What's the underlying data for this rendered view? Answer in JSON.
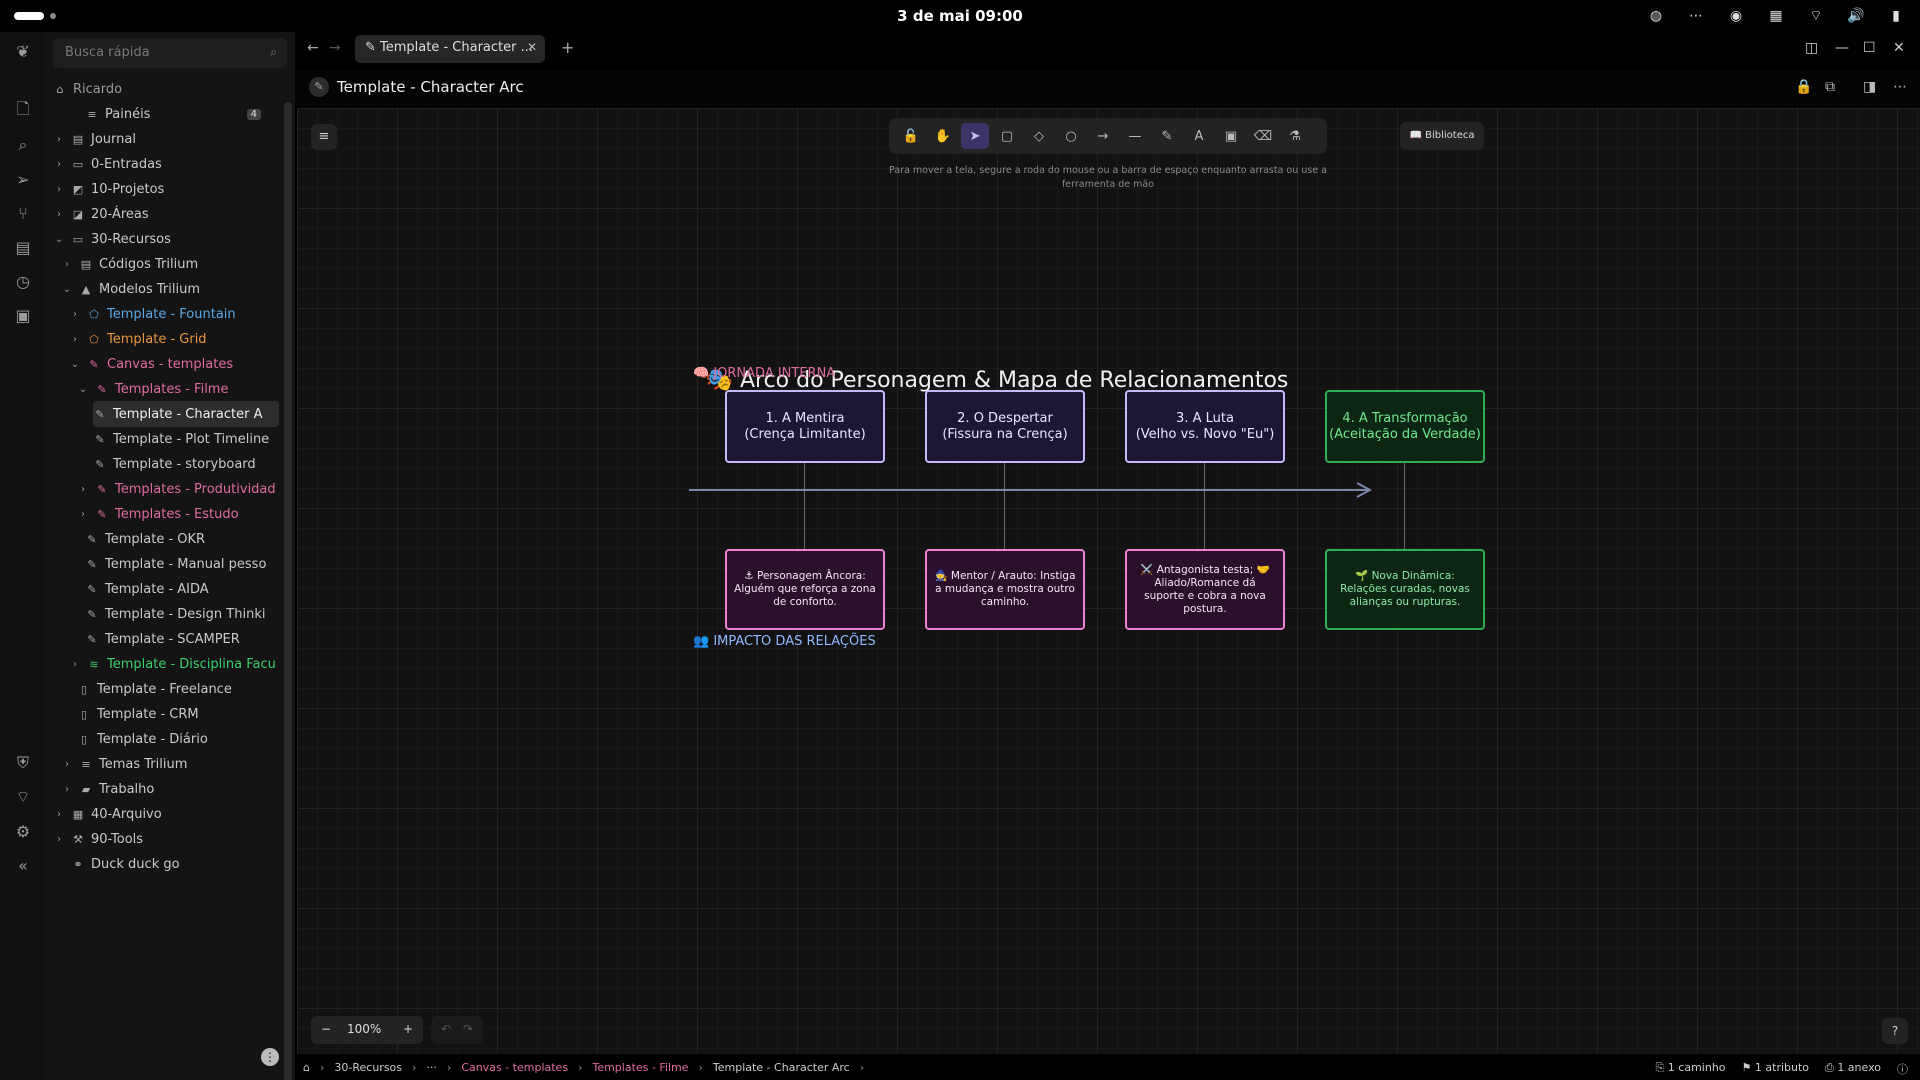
{
  "system": {
    "clock": "3 de mai  09:00"
  },
  "sidebar": {
    "search_placeholder": "Busca rápida",
    "root": "Ricardo",
    "items": [
      {
        "label": "Painéis",
        "badge": "4"
      },
      {
        "label": "Journal"
      },
      {
        "label": "0-Entradas"
      },
      {
        "label": "10-Projetos"
      },
      {
        "label": "20-Áreas"
      },
      {
        "label": "30-Recursos"
      },
      {
        "label": "Códigos Trilium"
      },
      {
        "label": "Modelos Trilium"
      },
      {
        "label": "Template - Fountain"
      },
      {
        "label": "Template - Grid"
      },
      {
        "label": "Canvas - templates"
      },
      {
        "label": "Templates - Filme"
      },
      {
        "label": "Template - Character A"
      },
      {
        "label": "Template - Plot Timeline"
      },
      {
        "label": "Template - storyboard"
      },
      {
        "label": "Templates - Produtividad"
      },
      {
        "label": "Templates - Estudo"
      },
      {
        "label": "Template - OKR"
      },
      {
        "label": "Template - Manual pesso"
      },
      {
        "label": "Template - AIDA"
      },
      {
        "label": "Template - Design Thinki"
      },
      {
        "label": "Template - SCAMPER"
      },
      {
        "label": "Template - Disciplina Facu"
      },
      {
        "label": "Template - Freelance"
      },
      {
        "label": "Template - CRM"
      },
      {
        "label": "Template - Diário"
      },
      {
        "label": "Temas Trilium"
      },
      {
        "label": "Trabalho"
      },
      {
        "label": "40-Arquivo"
      },
      {
        "label": "90-Tools"
      },
      {
        "label": "Duck duck go"
      }
    ]
  },
  "tabs": {
    "active": "Template - Character ..."
  },
  "note": {
    "title": "Template - Character Arc"
  },
  "canvas": {
    "hint": "Para mover a tela, segure a roda do mouse ou a barra de espaço enquanto arrasta ou use a ferramenta de mão",
    "library": "Biblioteca",
    "board_title": "🎭 Arco do Personagem & Mapa de Relacionamentos",
    "section_internal": "🧠 JORNADA INTERNA",
    "section_relations": "👥 IMPACTO DAS RELAÇÕES",
    "top_boxes": [
      {
        "line1": "1. A Mentira",
        "line2": "(Crença Limitante)"
      },
      {
        "line1": "2. O Despertar",
        "line2": "(Fissura na Crença)"
      },
      {
        "line1": "3. A Luta",
        "line2": "(Velho vs. Novo \"Eu\")"
      },
      {
        "line1": "4. A Transformação",
        "line2": "(Aceitação da Verdade)"
      }
    ],
    "bottom_boxes": [
      {
        "text": "⚓ Personagem Âncora: Alguém que reforça a zona de conforto."
      },
      {
        "text": "🧙 Mentor / Arauto: Instiga a mudança e mostra outro caminho."
      },
      {
        "text": "⚔️ Antagonista testa; 🤝 Aliado/Romance dá suporte e cobra a nova postura."
      },
      {
        "text": "🌱 Nova Dinâmica: Relações curadas, novas alianças ou rupturas."
      }
    ],
    "zoom": "100%"
  },
  "statusbar": {
    "crumbs": [
      "30-Recursos",
      "···",
      "Canvas - templates",
      "Templates - Filme",
      "Template - Character Arc"
    ],
    "paths": "1 caminho",
    "attributes": "1 atributo",
    "attachments": "1 anexo"
  },
  "colors": {
    "accent_pink": "#e06ba0",
    "accent_green": "#2fae52",
    "accent_purple": "#c9b8ff"
  }
}
